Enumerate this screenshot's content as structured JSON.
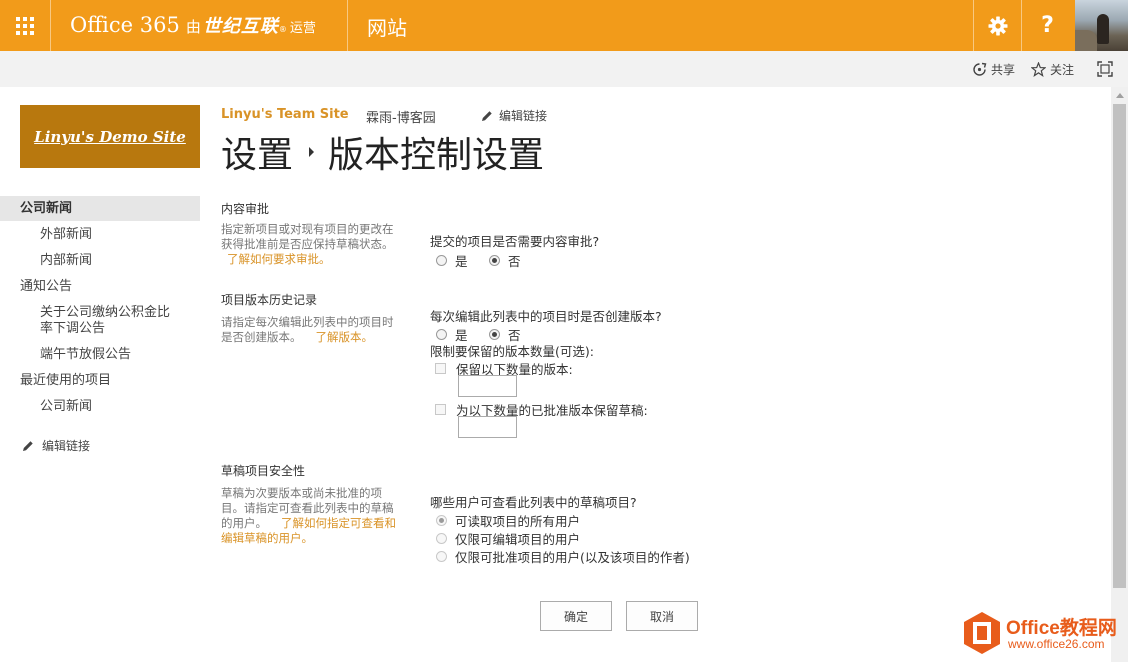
{
  "suite_bar": {
    "brand_office": "Office 365",
    "brand_by": "由",
    "brand_21v": "世纪互联",
    "brand_reg": "®",
    "brand_operated": "运营",
    "app_title": "网站",
    "help_label": "?",
    "bg_color": "#f29b1a"
  },
  "sub_bar": {
    "share_label": "共享",
    "follow_label": "关注"
  },
  "site": {
    "logo_text": "Linyu's Demo Site",
    "team_site": "Linyu's Team Site",
    "blog_link": "霖雨-博客园",
    "edit_links": "编辑链接"
  },
  "page_title": {
    "part1": "设置",
    "part2": "版本控制设置"
  },
  "nav": {
    "items": [
      {
        "label": "公司新闻",
        "selected": true
      },
      {
        "label": "外部新闻"
      },
      {
        "label": "内部新闻"
      },
      {
        "label": "通知公告"
      },
      {
        "label": "关于公司缴纳公积金比"
      },
      {
        "label": "率下调公告"
      },
      {
        "label": "端午节放假公告"
      },
      {
        "label": "最近使用的项目"
      },
      {
        "label": "公司新闻"
      }
    ],
    "edit_links": "编辑链接"
  },
  "content_approval": {
    "title": "内容审批",
    "desc_line1": "指定新项目或对现有项目的更改在",
    "desc_line2": "获得批准前是否应保持草稿状态。",
    "learn_more": "了解如何要求审批。",
    "question": "提交的项目是否需要内容审批?",
    "opt_yes": "是",
    "opt_no": "否",
    "selected": "否"
  },
  "version_history": {
    "title": "项目版本历史记录",
    "desc_line1": "请指定每次编辑此列表中的项目时",
    "desc_line2": "是否创建版本。",
    "learn_more": "了解版本。",
    "question": "每次编辑此列表中的项目时是否创建版本?",
    "opt_yes": "是",
    "opt_no": "否",
    "selected": "否",
    "limit_label": "限制要保留的版本数量(可选):",
    "keep_versions_label": "保留以下数量的版本:",
    "keep_versions_value": "",
    "keep_drafts_label": "为以下数量的已批准版本保留草稿:",
    "keep_drafts_value": ""
  },
  "draft_security": {
    "title": "草稿项目安全性",
    "desc_line1": "草稿为次要版本或尚未批准的项",
    "desc_line2": "目。请指定可查看此列表中的草稿",
    "desc_line3": "的用户。",
    "learn_more_1": "了解如何指定可查看和",
    "learn_more_2": "编辑草稿的用户。",
    "question": "哪些用户可查看此列表中的草稿项目?",
    "options": [
      "可读取项目的所有用户",
      "仅限可编辑项目的用户",
      "仅限可批准项目的用户(以及该项目的作者)"
    ],
    "selected": "可读取项目的所有用户"
  },
  "buttons": {
    "ok": "确定",
    "cancel": "取消"
  },
  "watermark": {
    "line1": "Office教程网",
    "line2": "www.office26.com"
  }
}
